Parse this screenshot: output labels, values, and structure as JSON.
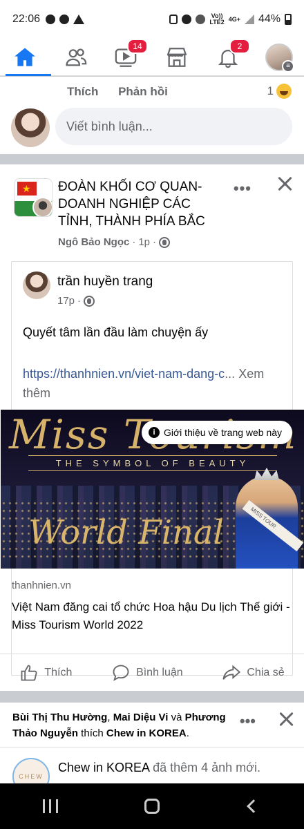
{
  "status_bar": {
    "time": "22:06",
    "network_top": "Vo))",
    "network_bottom": "LTE2",
    "network_type": "4G+",
    "battery": "44%",
    "icons": [
      "messenger-icon",
      "facebook-icon",
      "warning-icon",
      "lock-icon",
      "alarm-icon",
      "mute-icon",
      "signal-icon",
      "battery-icon"
    ]
  },
  "nav": {
    "items": [
      {
        "name": "home",
        "icon": "home-icon",
        "active": true
      },
      {
        "name": "friends",
        "icon": "friends-icon"
      },
      {
        "name": "watch",
        "icon": "video-icon",
        "badge": "14"
      },
      {
        "name": "marketplace",
        "icon": "store-icon"
      },
      {
        "name": "notifications",
        "icon": "bell-icon",
        "badge": "2"
      },
      {
        "name": "menu",
        "icon": "avatar-menu-icon"
      }
    ],
    "accent_color": "#1877f2",
    "badge_color": "#e41e3f"
  },
  "comment_strip": {
    "like_label": "Thích",
    "reply_label": "Phản hồi",
    "reaction_count": "1",
    "reaction_icon": "haha-emoji-icon",
    "input_placeholder": "Viết bình luận..."
  },
  "post": {
    "page_name": "ĐOÀN KHỐI CƠ QUAN-DOANH NGHIỆP CÁC TỈNH, THÀNH PHÍA BẮC",
    "author": "Ngô Bảo Ngọc",
    "time": "1p",
    "privacy_icon": "globe-icon",
    "more_label": "•••",
    "shared": {
      "author": "trần huyền trang",
      "time": "17p",
      "text": "Quyết tâm lần đầu làm chuyện ấy",
      "url": "https://thanhnien.vn/viet-nam-dang-c",
      "ellipsis": "...",
      "see_more": "Xem thêm",
      "image": {
        "logo_text": "Miss Tourism",
        "tagline": "THE SYMBOL OF BEAUTY",
        "headline": "World Final",
        "sash_text": "MISS TOUR",
        "tooltip": "Giới thiệu về trang web này"
      },
      "link_domain": "thanhnien.vn",
      "link_title": "Việt Nam đăng cai tổ chức Hoa hậu Du lịch Thế giới - Miss Tourism World 2022"
    },
    "actions": {
      "like": "Thích",
      "comment": "Bình luận",
      "share": "Chia sẻ"
    }
  },
  "post2": {
    "actor_1": "Bùi Thị Thu Hường",
    "sep_1": ", ",
    "actor_2": "Mai Diệu Vi",
    "sep_2": " và ",
    "actor_3": "Phương Thảo Nguyễn",
    "verb": " thích ",
    "target": "Chew in KOREA",
    "end": ".",
    "more_label": "•••",
    "page_name": "Chew in KOREA",
    "page_action": " đã thêm 4 ảnh mới.",
    "avatar_text": "CHEW"
  }
}
